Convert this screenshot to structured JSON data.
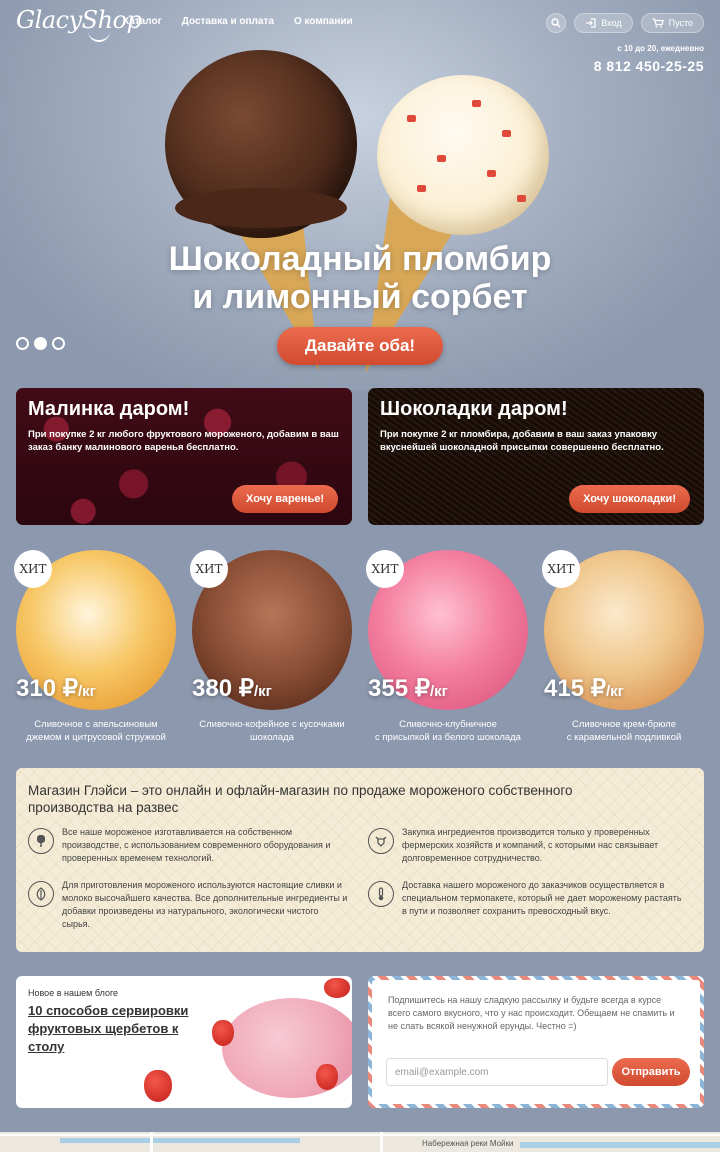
{
  "header": {
    "logo": "GlacyShop",
    "nav": [
      "Каталог",
      "Доставка и оплата",
      "О компании"
    ],
    "login_label": "Вход",
    "cart_label": "Пусто",
    "hours": "с 10 до 20, ежедневно",
    "phone": "8 812 450-25-25"
  },
  "hero": {
    "title_line1": "Шоколадный пломбир",
    "title_line2": "и лимонный сорбет",
    "cta": "Давайте оба!",
    "slides": 3,
    "active_slide": 2
  },
  "promos": [
    {
      "title": "Малинка даром!",
      "text": "При покупке 2 кг любого фруктового мороженого, добавим в ваш заказ банку малинового варенья бесплатно.",
      "button": "Хочу варенье!"
    },
    {
      "title": "Шоколадки даром!",
      "text": "При покупке 2 кг пломбира, добавим в ваш заказ упаковку вкуснейшей шоколадной присыпки совершенно бесплатно.",
      "button": "Хочу шоколадки!"
    }
  ],
  "products": [
    {
      "badge": "ХИТ",
      "price": "310 ₽",
      "unit": "/кг",
      "name_line1": "Сливочное с апельсиновым",
      "name_line2": "джемом и цитрусовой стружкой"
    },
    {
      "badge": "ХИТ",
      "price": "380 ₽",
      "unit": "/кг",
      "name_line1": "Сливочно-кофейное с кусочками",
      "name_line2": "шоколада"
    },
    {
      "badge": "ХИТ",
      "price": "355 ₽",
      "unit": "/кг",
      "name_line1": "Сливочно-клубничное",
      "name_line2": "с присыпкой из белого шоколада"
    },
    {
      "badge": "ХИТ",
      "price": "415 ₽",
      "unit": "/кг",
      "name_line1": "Сливочное крем-брюле",
      "name_line2": "с карамельной подливкой"
    }
  ],
  "about": {
    "title": "Магазин Глэйси – это онлайн и офлайн-магазин по продаже мороженого собственного производства на развес",
    "features": [
      {
        "icon": "ice-cream-icon",
        "text": "Все наше мороженое изготавливается на собственном производстве, с использованием современного оборудования и проверенных временем технологий."
      },
      {
        "icon": "cow-icon",
        "text": "Закупка ингредиентов производится только у проверенных фермерских хозяйств и компаний, с которыми нас связывает долговременное сотрудничество."
      },
      {
        "icon": "leaf-icon",
        "text": "Для приготовления мороженого используются настоящие сливки и молоко высочайшего качества. Все дополнительные ингредиенты и добавки произведены из натурального, экологически чистого сырья."
      },
      {
        "icon": "thermometer-icon",
        "text": "Доставка нашего мороженого до заказчиков осуществляется в специальном термопакете, который не дает мороженому растаять в пути и позволяет сохранить превосходный вкус."
      }
    ]
  },
  "blog": {
    "kicker": "Новое в нашем блоге",
    "title": "10 способов сервировки фруктовых щербетов к столу"
  },
  "subscribe": {
    "text": "Подпишитесь на нашу сладкую рассылку и будьте всегда в курсе всего самого вкусного, что у нас происходит. Обещаем не спамить и не слать всякой ненужной ерунды. Честно =)",
    "placeholder": "email@example.com",
    "button": "Отправить"
  },
  "map": {
    "label": "Набережная реки Мойки"
  },
  "colors": {
    "accent": "#e0583b",
    "page_bg": "#8b98ad",
    "about_bg": "#f5ecd7"
  }
}
